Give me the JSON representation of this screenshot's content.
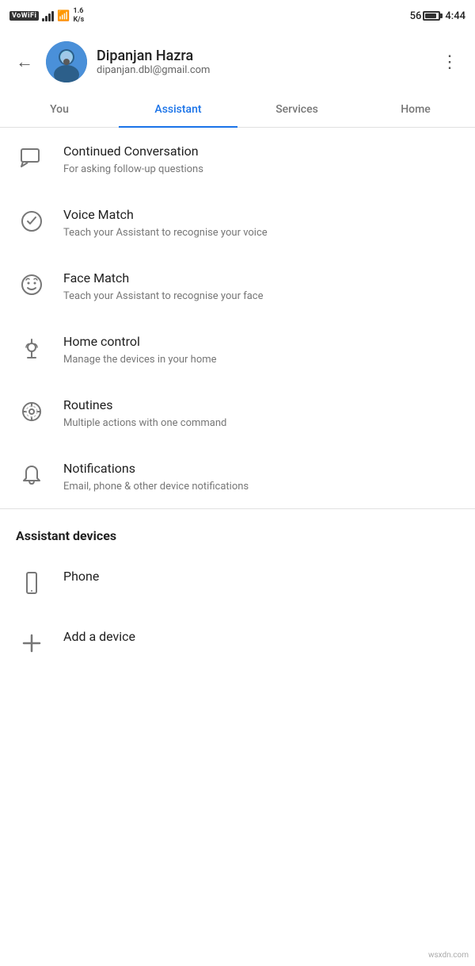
{
  "statusBar": {
    "vowifi": "VoWiFi",
    "speed": "1.6\nK/s",
    "time": "4:44",
    "batteryLevel": "56"
  },
  "header": {
    "userName": "Dipanjan Hazra",
    "userEmail": "dipanjan.dbl@gmail.com"
  },
  "tabs": [
    {
      "id": "you",
      "label": "You",
      "active": false
    },
    {
      "id": "assistant",
      "label": "Assistant",
      "active": true
    },
    {
      "id": "services",
      "label": "Services",
      "active": false
    },
    {
      "id": "home",
      "label": "Home",
      "active": false
    }
  ],
  "listItems": [
    {
      "id": "continued-conversation",
      "title": "Continued Conversation",
      "desc": "For asking follow-up questions",
      "icon": "chat"
    },
    {
      "id": "voice-match",
      "title": "Voice Match",
      "desc": "Teach your Assistant to recognise your voice",
      "icon": "voice"
    },
    {
      "id": "face-match",
      "title": "Face Match",
      "desc": "Teach your Assistant to recognise your face",
      "icon": "face"
    },
    {
      "id": "home-control",
      "title": "Home control",
      "desc": "Manage the devices in your home",
      "icon": "home"
    },
    {
      "id": "routines",
      "title": "Routines",
      "desc": "Multiple actions with one command",
      "icon": "routines"
    },
    {
      "id": "notifications",
      "title": "Notifications",
      "desc": "Email, phone & other device notifications",
      "icon": "bell"
    }
  ],
  "assistantDevices": {
    "sectionTitle": "Assistant devices",
    "devices": [
      {
        "id": "phone",
        "label": "Phone",
        "icon": "phone"
      }
    ],
    "addDevice": "Add a device"
  },
  "watermark": "wsxdn.com"
}
